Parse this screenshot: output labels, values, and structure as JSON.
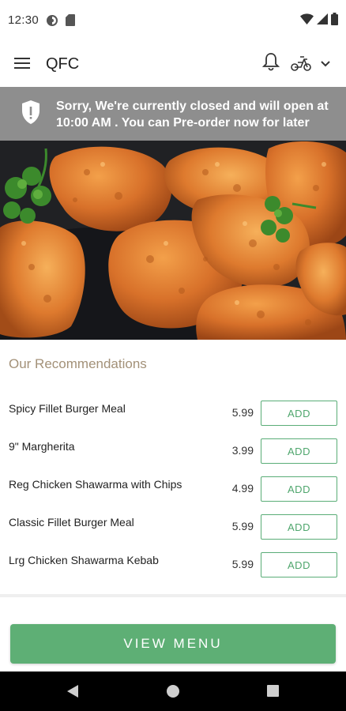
{
  "status_bar": {
    "time": "12:30",
    "icons": [
      "data-saver-icon",
      "sim-card-icon",
      "wifi-icon",
      "signal-icon",
      "battery-icon"
    ]
  },
  "app_bar": {
    "title": "QFC",
    "icons": [
      "menu-icon",
      "bell-icon",
      "scooter-icon",
      "chevron-down-icon"
    ]
  },
  "banner": {
    "icon": "shield-alert-icon",
    "message": "Sorry, We're currently closed and will open at 10:00 AM . You can Pre-order now for later"
  },
  "hero": {
    "subject": "fried-chicken-photo"
  },
  "recommendations": {
    "title": "Our Recommendations",
    "add_label": "ADD",
    "items": [
      {
        "name": "Spicy Fillet Burger Meal",
        "price": "5.99"
      },
      {
        "name": "9\" Margherita",
        "price": "3.99"
      },
      {
        "name": "Reg Chicken Shawarma with Chips",
        "price": "4.99"
      },
      {
        "name": "Classic Fillet Burger Meal",
        "price": "5.99"
      },
      {
        "name": "Lrg Chicken Shawarma Kebab",
        "price": "5.99"
      }
    ]
  },
  "cta": {
    "view_menu_label": "VIEW MENU"
  },
  "colors": {
    "accent_green": "#5eaf75",
    "banner_gray": "#8e8e8e",
    "heading_tan": "#a39178"
  }
}
